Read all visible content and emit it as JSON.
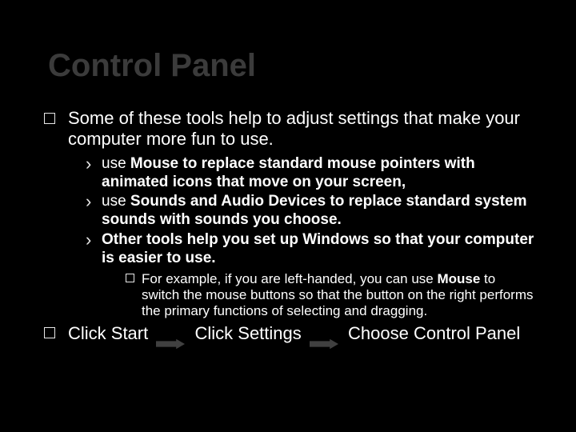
{
  "title": "Control Panel",
  "bullet1": "Some of these tools help to adjust settings that make your computer more fun to use.",
  "sub1_pre": "use ",
  "sub1_b": "Mouse to replace standard mouse pointers with animated icons that move on your screen,",
  "sub2_pre": "use ",
  "sub2_b": "Sounds and Audio Devices to replace standard system sounds with sounds you choose.",
  "sub3": "Other tools help you set up Windows so that your computer is easier to use.",
  "sub3a_pre": "For example, if you are left-handed, you can use ",
  "sub3a_b": "Mouse",
  "sub3a_post": " to switch the mouse buttons so that the button on the right performs the primary functions of selecting and dragging.",
  "step1": "Click Start",
  "step2": "Click Settings",
  "step3": "Choose Control Panel"
}
